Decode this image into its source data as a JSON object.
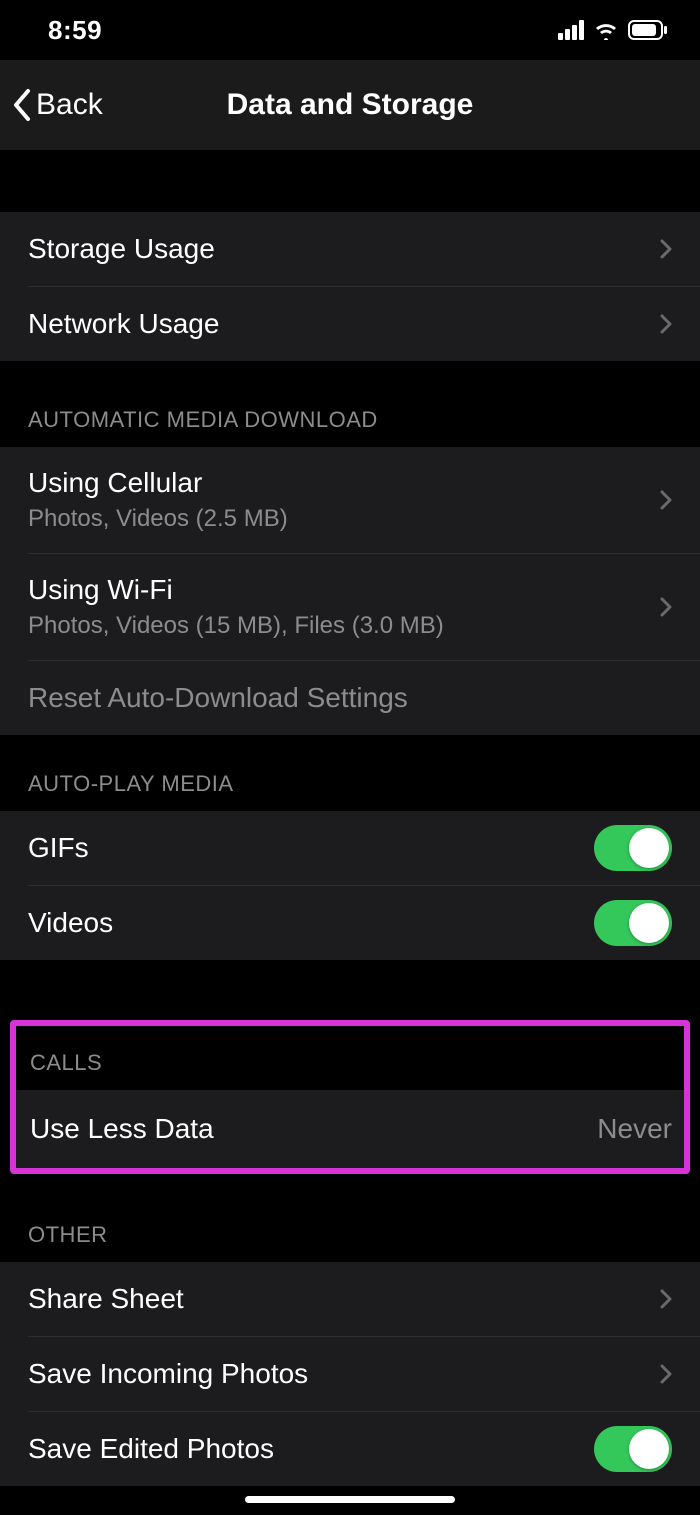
{
  "status": {
    "time": "8:59"
  },
  "nav": {
    "back": "Back",
    "title": "Data and Storage"
  },
  "usage": {
    "storage": "Storage Usage",
    "network": "Network Usage"
  },
  "auto_download": {
    "header": "AUTOMATIC MEDIA DOWNLOAD",
    "cellular": {
      "label": "Using Cellular",
      "sub": "Photos, Videos (2.5 MB)"
    },
    "wifi": {
      "label": "Using Wi-Fi",
      "sub": "Photos, Videos (15 MB), Files (3.0 MB)"
    },
    "reset": "Reset Auto-Download Settings"
  },
  "autoplay": {
    "header": "AUTO-PLAY MEDIA",
    "gifs": "GIFs",
    "videos": "Videos"
  },
  "calls": {
    "header": "CALLS",
    "use_less": {
      "label": "Use Less Data",
      "value": "Never"
    }
  },
  "other": {
    "header": "OTHER",
    "share_sheet": "Share Sheet",
    "save_incoming": "Save Incoming Photos",
    "save_edited": "Save Edited Photos"
  }
}
